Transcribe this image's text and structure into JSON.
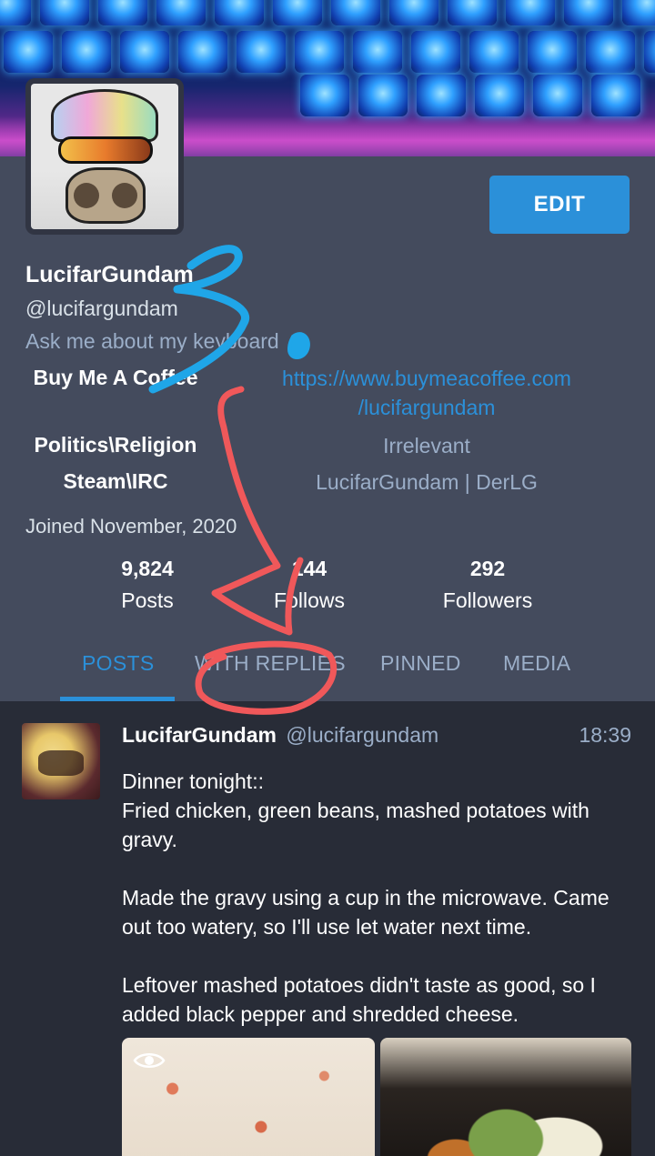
{
  "profile": {
    "display_name": "LucifarGundam",
    "acct": "@lucifargundam",
    "bio": "Ask me about my keyboard",
    "edit_label": "EDIT",
    "fields": [
      {
        "name": "Buy Me A Coffee",
        "value_line1": "https://www.buymeacoffee.com",
        "value_line2": "/lucifargundam"
      },
      {
        "name": "Politics\\Religion",
        "value": "Irrelevant"
      },
      {
        "name": "Steam\\IRC",
        "value": "LucifarGundam | DerLG"
      }
    ],
    "joined": "Joined November, 2020",
    "stats": {
      "posts": {
        "count": "9,824",
        "label": "Posts"
      },
      "follows": {
        "count": "144",
        "label": "Follows"
      },
      "followers": {
        "count": "292",
        "label": "Followers"
      }
    }
  },
  "tabs": [
    "POSTS",
    "WITH REPLIES",
    "PINNED",
    "MEDIA"
  ],
  "active_tab": "POSTS",
  "status": {
    "display_name": "LucifarGundam",
    "acct": "@lucifargundam",
    "time": "18:39",
    "paragraphs": [
      "Dinner tonight::\nFried chicken, green beans, mashed potatoes with gravy.",
      "Made the gravy using a cup in the microwave. Came out too watery, so I'll use let water next time.",
      "Leftover mashed potatoes didn't taste as good, so I added black pepper and shredded cheese."
    ]
  },
  "colors": {
    "accent": "#2b90d9",
    "profile_bg": "#444b5d",
    "timeline_bg": "#282c37",
    "muted_text": "#9baec8",
    "annotation_blue": "#1fa6e8",
    "annotation_red": "#f0585a"
  },
  "icons": [
    "eye-icon"
  ]
}
